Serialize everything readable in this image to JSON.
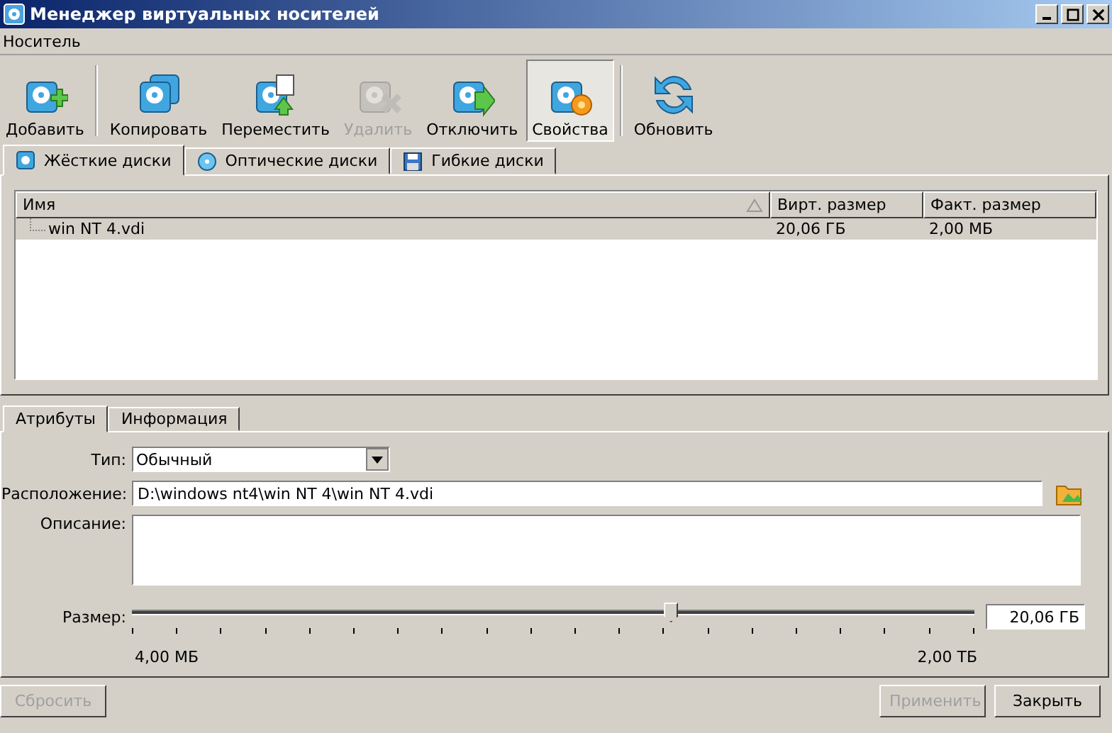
{
  "window": {
    "title": "Менеджер виртуальных носителей"
  },
  "menu": [
    "Носитель"
  ],
  "toolbar": [
    {
      "label": "Добавить",
      "kind": "add",
      "disabled": false,
      "selected": false
    },
    {
      "kind": "separator"
    },
    {
      "label": "Копировать",
      "kind": "copy",
      "disabled": false,
      "selected": false
    },
    {
      "label": "Переместить",
      "kind": "move",
      "disabled": false,
      "selected": false
    },
    {
      "label": "Удалить",
      "kind": "remove",
      "disabled": true,
      "selected": false
    },
    {
      "label": "Отключить",
      "kind": "release",
      "disabled": false,
      "selected": false
    },
    {
      "label": "Свойства",
      "kind": "properties",
      "disabled": false,
      "selected": true
    },
    {
      "kind": "separator"
    },
    {
      "label": "Обновить",
      "kind": "refresh",
      "disabled": false,
      "selected": false
    }
  ],
  "media_tabs": [
    {
      "label": "Жёсткие диски",
      "kind": "hdd",
      "selected": true
    },
    {
      "label": "Оптические диски",
      "kind": "optical",
      "selected": false
    },
    {
      "label": "Гибкие диски",
      "kind": "floppy",
      "selected": false
    }
  ],
  "table": {
    "columns": [
      "Имя",
      "Вирт. размер",
      "Факт. размер"
    ],
    "rows": [
      {
        "cells": [
          "win NT 4.vdi",
          "20,06 ГБ",
          "2,00 МБ"
        ],
        "selected": true
      }
    ]
  },
  "detail_tabs": [
    {
      "label": "Атрибуты",
      "selected": true
    },
    {
      "label": "Информация",
      "selected": false
    }
  ],
  "attributes": {
    "type_label": "Тип:",
    "type_value": "Обычный",
    "location_label": "Расположение:",
    "location_value": "D:\\windows nt4\\win NT 4\\win NT 4.vdi",
    "description_label": "Описание:",
    "size_label": "Размер:",
    "size": {
      "level": 0.64,
      "value": "20,06 ГБ",
      "min": "4,00 МБ",
      "max": "2,00 ТБ"
    }
  },
  "buttons": [
    {
      "label": "Сбросить",
      "disabled": true
    },
    {
      "label": "Применить",
      "disabled": true
    },
    {
      "label": "Закрыть",
      "disabled": false
    }
  ]
}
